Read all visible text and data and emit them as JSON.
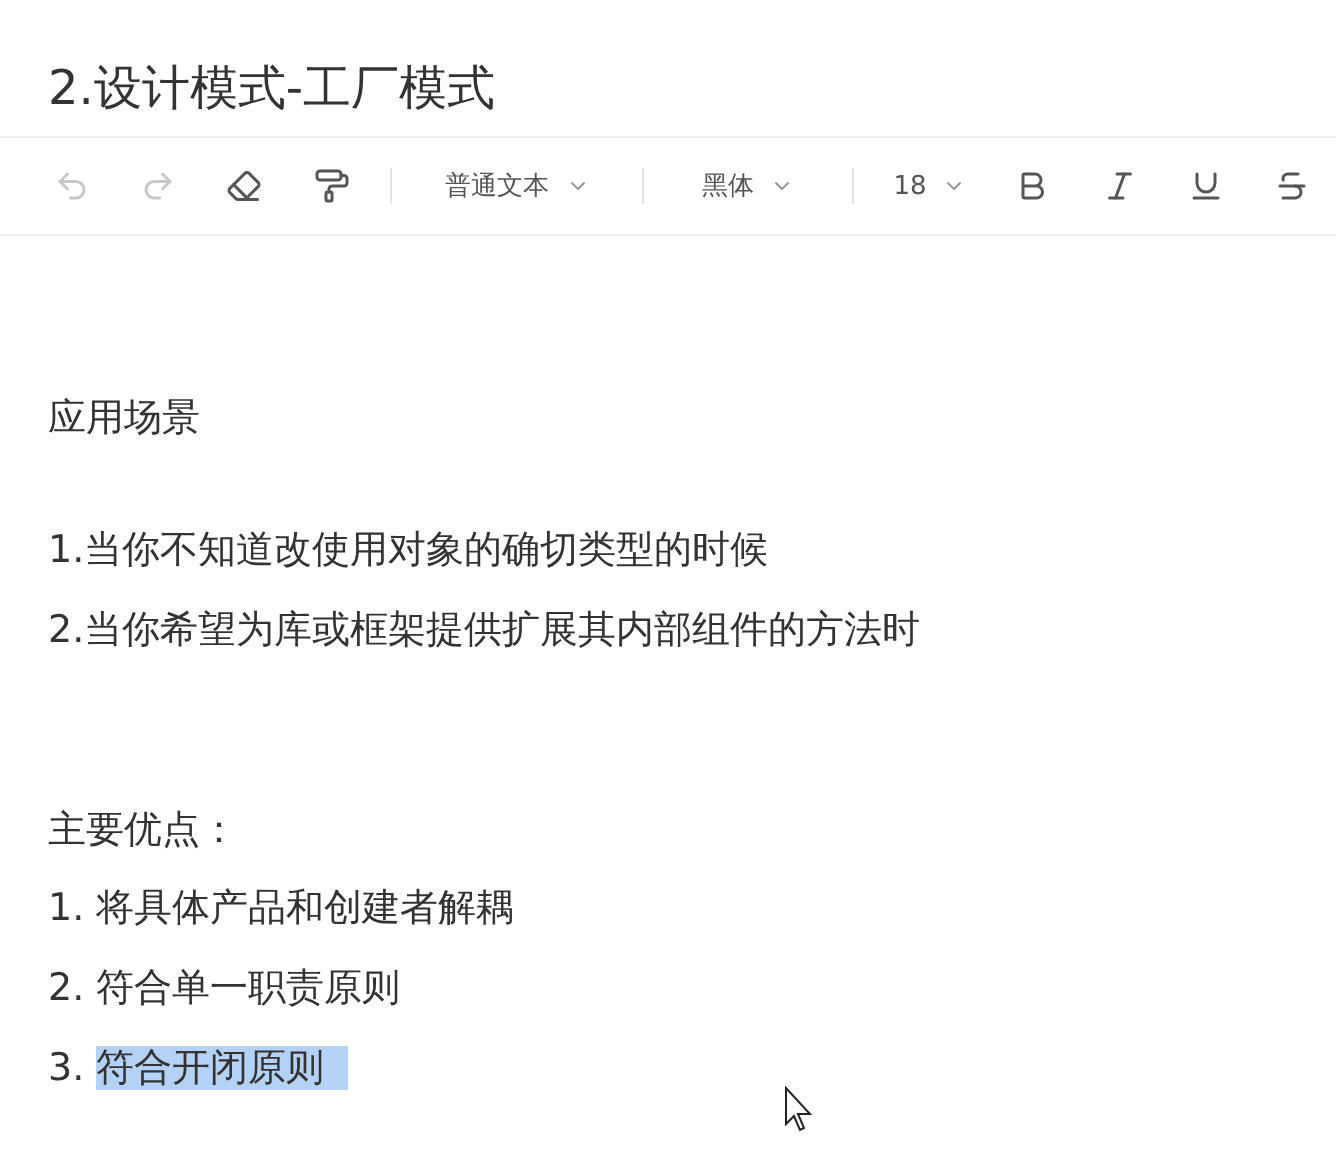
{
  "title": "2.设计模式-工厂模式",
  "toolbar": {
    "undo": {
      "disabled": true
    },
    "redo": {
      "disabled": true
    },
    "paragraph_style": "普通文本",
    "font": "黑体",
    "font_size": "18"
  },
  "sections": [
    {
      "heading": "应用场景",
      "blank_after_heading": true,
      "items": [
        {
          "lead": "1.",
          "text": "当你不知道改使用对象的确切类型的时候",
          "selected": false
        },
        {
          "lead": "2.",
          "text": "当你希望为库或框架提供扩展其内部组件的方法时",
          "selected": false
        }
      ]
    },
    {
      "heading": "主要优点：",
      "blank_after_heading": false,
      "items": [
        {
          "lead": "1. ",
          "text": "将具体产品和创建者解耦",
          "selected": false
        },
        {
          "lead": "2. ",
          "text": "符合单一职责原则",
          "selected": false
        },
        {
          "lead": "3. ",
          "text": "符合开闭原则",
          "selected": true
        }
      ]
    }
  ]
}
